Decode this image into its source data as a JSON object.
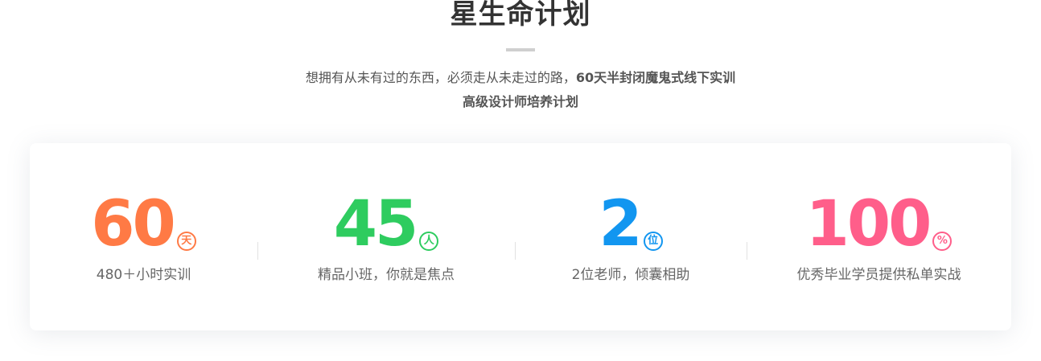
{
  "header": {
    "title": "星生命计划",
    "subtitle_normal": "想拥有从未有过的东西，必须走从未走过的路，",
    "subtitle_bold": "60天半封闭魔鬼式线下实训",
    "subtitle_line2": "高级设计师培养计划"
  },
  "stats": [
    {
      "number": "60",
      "unit": "天",
      "caption": "480＋小时实训",
      "color": "#ff7a45"
    },
    {
      "number": "45",
      "unit": "人",
      "caption": "精品小班，你就是焦点",
      "color": "#2ecc5f"
    },
    {
      "number": "2",
      "unit": "位",
      "caption": "2位老师，倾囊相助",
      "color": "#1296f0"
    },
    {
      "number": "100",
      "unit": "%",
      "caption": "优秀毕业学员提供私单实战",
      "color": "#ff5e8a"
    }
  ]
}
